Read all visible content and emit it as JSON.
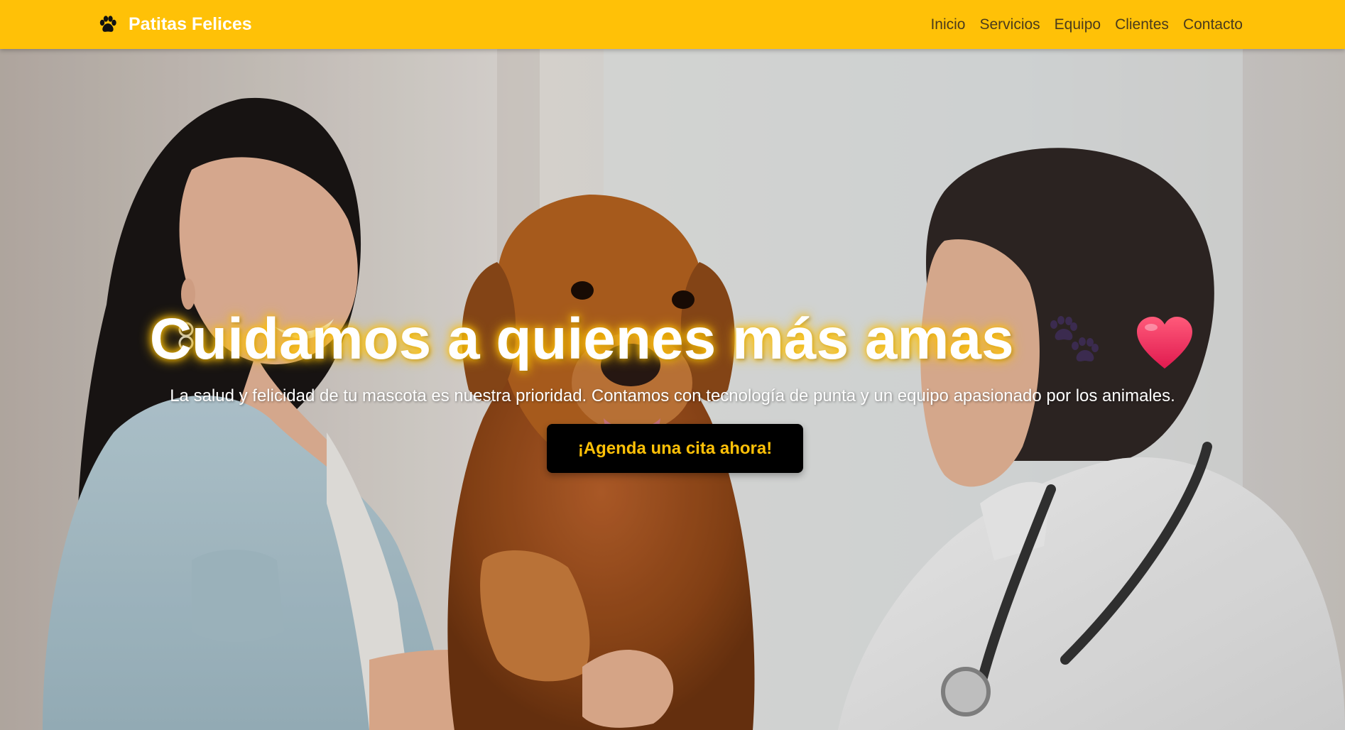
{
  "navbar": {
    "brand": "Patitas Felices",
    "brand_icon": "paw-icon",
    "links": [
      "Inicio",
      "Servicios",
      "Equipo",
      "Clientes",
      "Contacto"
    ]
  },
  "hero": {
    "title": "Cuidamos a quienes más amas",
    "title_emojis": [
      "paw-prints-icon",
      "heart-icon"
    ],
    "subtitle": "La salud y felicidad de tu mascota es nuestra prioridad. Contamos con tecnología de punta y un equipo apasionado por los animales.",
    "cta_label": "¡Agenda una cita ahora!",
    "background": "photo of a smiling woman and a veterinarian shaking hands with a golden retriever between them"
  },
  "colors": {
    "brand_yellow": "#FFC107",
    "nav_link": "#4a3b1c",
    "cta_bg": "#000000",
    "cta_text": "#FFC107"
  }
}
